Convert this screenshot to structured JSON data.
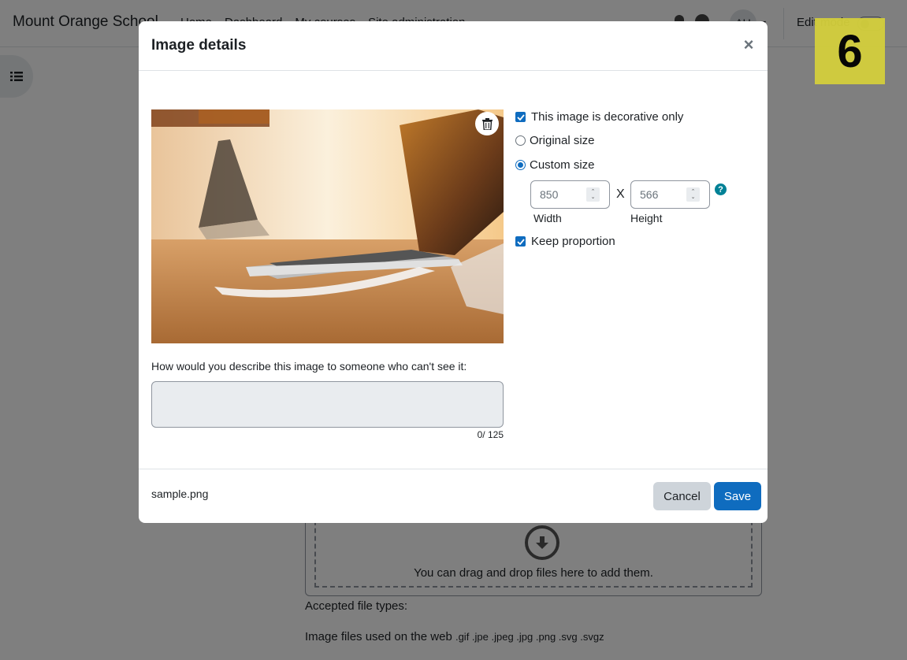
{
  "navbar": {
    "site_name": "Mount Orange School",
    "links": [
      "Home",
      "Dashboard",
      "My courses",
      "Site administration"
    ],
    "avatar_initials": "AU",
    "edit_mode_label": "Edit mode",
    "icons": [
      "bell-icon",
      "chat-icon"
    ]
  },
  "page": {
    "dropzone_text": "You can drag and drop files here to add them.",
    "accepted_label": "Accepted file types:",
    "accepted_files_label": "Image files used on the web",
    "accepted_extensions": ".gif .jpe .jpeg .jpg .png .svg .svgz"
  },
  "step_badge": "6",
  "modal": {
    "title": "Image details",
    "close_glyph": "×",
    "decorative_label": "This image is decorative only",
    "decorative_checked": true,
    "original_size_label": "Original size",
    "custom_size_label": "Custom size",
    "size_mode": "custom",
    "width_value": "850",
    "height_value": "566",
    "times_symbol": "X",
    "width_label": "Width",
    "height_label": "Height",
    "help_glyph": "?",
    "keep_proportion_label": "Keep proportion",
    "keep_proportion_checked": true,
    "description_label": "How would you describe this image to someone who can't see it:",
    "description_value": "",
    "char_count": "0/ 125",
    "filename": "sample.png",
    "cancel_label": "Cancel",
    "save_label": "Save"
  },
  "colors": {
    "primary": "#0f6cbf",
    "help": "#008196",
    "badge": "#d4cf3c",
    "backdrop": "rgba(0,0,0,0.5)"
  }
}
